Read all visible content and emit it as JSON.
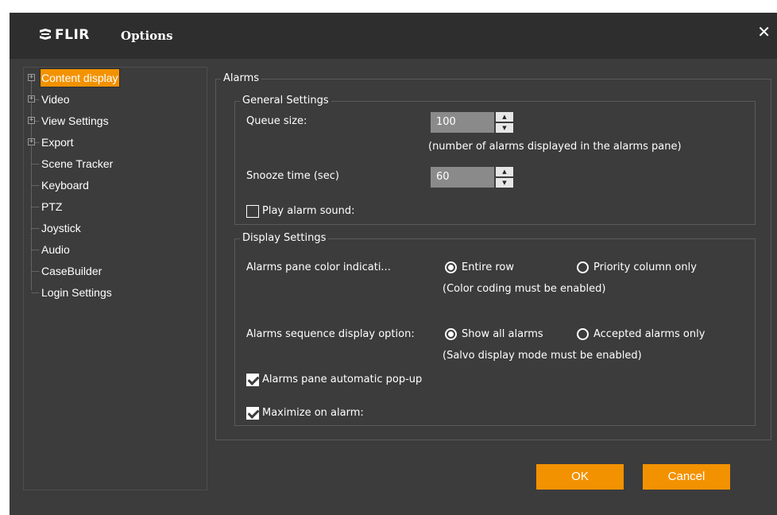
{
  "window": {
    "brand": "FLIR",
    "title": "Options",
    "close_symbol": "✕"
  },
  "tree": {
    "items": [
      {
        "label": "Content display",
        "expandable": true,
        "selected": true
      },
      {
        "label": "Video",
        "expandable": true
      },
      {
        "label": "View Settings",
        "expandable": true
      },
      {
        "label": "Export",
        "expandable": true
      },
      {
        "label": "Scene Tracker",
        "expandable": false
      },
      {
        "label": "Keyboard",
        "expandable": false
      },
      {
        "label": "PTZ",
        "expandable": false
      },
      {
        "label": "Joystick",
        "expandable": false
      },
      {
        "label": "Audio",
        "expandable": false
      },
      {
        "label": "CaseBuilder",
        "expandable": false
      },
      {
        "label": "Login Settings",
        "expandable": false
      }
    ],
    "expander_symbol": "+"
  },
  "alarms": {
    "group_title": "Alarms",
    "general": {
      "group_title": "General Settings",
      "queue_label": "Queue size:",
      "queue_value": "100",
      "queue_hint": "(number of alarms displayed in the alarms pane)",
      "snooze_label": "Snooze time (sec)",
      "snooze_value": "60",
      "play_sound_label": "Play alarm sound:",
      "play_sound_checked": false
    },
    "display": {
      "group_title": "Display Settings",
      "color_label": "Alarms pane color indicati...",
      "color_option_1": "Entire row",
      "color_option_2": "Priority column only",
      "color_selected": "Entire row",
      "color_hint": "(Color coding must be enabled)",
      "sequence_label": "Alarms sequence display option:",
      "sequence_option_1": "Show all alarms",
      "sequence_option_2": "Accepted alarms only",
      "sequence_selected": "Show all alarms",
      "sequence_hint": "(Salvo display mode must be enabled)",
      "popup_label": "Alarms pane automatic pop-up",
      "popup_checked": true,
      "maximize_label": "Maximize on alarm:",
      "maximize_checked": true
    }
  },
  "buttons": {
    "ok": "OK",
    "cancel": "Cancel"
  },
  "colors": {
    "accent": "#f39200",
    "background": "#3c3c3c",
    "titlebar": "#2e2e2e"
  }
}
